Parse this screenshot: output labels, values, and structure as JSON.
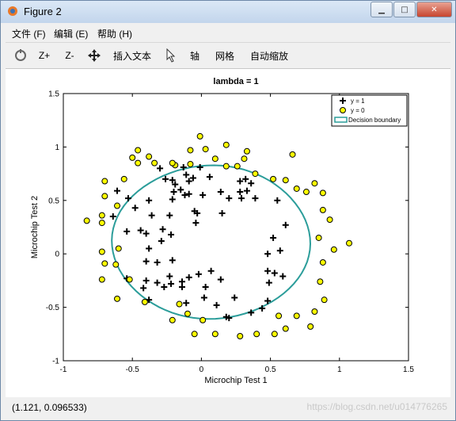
{
  "window": {
    "title": "Figure 2",
    "minimize_icon": "minimize-icon",
    "maximize_icon": "maximize-icon",
    "close_icon": "close-icon"
  },
  "menu": [
    {
      "label": "文件 (F)"
    },
    {
      "label": "编辑 (E)"
    },
    {
      "label": "帮助 (H)"
    }
  ],
  "toolbar": {
    "rotate_icon": "rotate-icon",
    "zoom_in": "Z+",
    "zoom_out": "Z-",
    "pan_icon": "pan-move-icon",
    "insert_text": "插入文本",
    "select_icon": "cursor-icon",
    "axes": "轴",
    "grid": "网格",
    "autoscale": "自动缩放"
  },
  "status": {
    "coords": "(1.121, 0.096533)",
    "watermark": "https://blog.csdn.net/u014776265"
  },
  "chart_data": {
    "type": "scatter",
    "title": "lambda = 1",
    "xlabel": "Microchip Test 1",
    "ylabel": "Microchip Test 2",
    "xlim": [
      -1,
      1.5
    ],
    "ylim": [
      -1,
      1.5
    ],
    "xticks": [
      "-1",
      "-0.5",
      "0",
      "0.5",
      "1",
      "1.5"
    ],
    "yticks": [
      "-1",
      "-0.5",
      "0",
      "0.5",
      "1",
      "1.5"
    ],
    "xtick_values": [
      -1,
      -0.5,
      0,
      0.5,
      1,
      1.5
    ],
    "ytick_values": [
      -1,
      -0.5,
      0,
      0.5,
      1,
      1.5
    ],
    "legend_position": "top-right",
    "legend": [
      "y = 1",
      "y = 0",
      "Decision boundary"
    ],
    "colors": {
      "positive": "#000000",
      "negative_fill": "#ffff00",
      "boundary": "#2b9d9a"
    },
    "series": [
      {
        "name": "y = 1",
        "marker": "plus",
        "points": [
          [
            -0.09,
            0.68
          ],
          [
            -0.21,
            0.69
          ],
          [
            -0.3,
            0.8
          ],
          [
            -0.26,
            0.7
          ],
          [
            -0.13,
            0.81
          ],
          [
            -0.11,
            0.74
          ],
          [
            -0.06,
            0.71
          ],
          [
            -0.01,
            0.81
          ],
          [
            0.06,
            0.72
          ],
          [
            0.14,
            0.58
          ],
          [
            0.2,
            0.52
          ],
          [
            0.29,
            0.52
          ],
          [
            0.33,
            0.59
          ],
          [
            0.28,
            0.68
          ],
          [
            0.32,
            0.7
          ],
          [
            0.28,
            0.58
          ],
          [
            -0.15,
            0.6
          ],
          [
            -0.2,
            0.58
          ],
          [
            -0.19,
            0.65
          ],
          [
            -0.12,
            0.55
          ],
          [
            -0.09,
            0.56
          ],
          [
            -0.21,
            0.51
          ],
          [
            -0.38,
            0.5
          ],
          [
            -0.48,
            0.43
          ],
          [
            -0.53,
            0.52
          ],
          [
            -0.61,
            0.59
          ],
          [
            -0.64,
            0.35
          ],
          [
            -0.54,
            0.21
          ],
          [
            -0.44,
            0.22
          ],
          [
            -0.38,
            0.05
          ],
          [
            -0.36,
            0.36
          ],
          [
            -0.23,
            0.36
          ],
          [
            -0.22,
            0.18
          ],
          [
            -0.29,
            0.12
          ],
          [
            -0.28,
            0.23
          ],
          [
            -0.32,
            -0.08
          ],
          [
            -0.4,
            -0.07
          ],
          [
            -0.21,
            -0.06
          ],
          [
            -0.23,
            -0.21
          ],
          [
            -0.22,
            -0.28
          ],
          [
            -0.32,
            -0.27
          ],
          [
            -0.4,
            -0.25
          ],
          [
            -0.42,
            -0.32
          ],
          [
            -0.38,
            -0.43
          ],
          [
            -0.27,
            -0.31
          ],
          [
            -0.14,
            -0.26
          ],
          [
            -0.09,
            -0.22
          ],
          [
            -0.02,
            -0.19
          ],
          [
            0.07,
            -0.16
          ],
          [
            0.14,
            -0.24
          ],
          [
            0.03,
            -0.31
          ],
          [
            -0.14,
            -0.31
          ],
          [
            -0.11,
            -0.46
          ],
          [
            0.02,
            -0.41
          ],
          [
            0.11,
            -0.48
          ],
          [
            0.24,
            -0.41
          ],
          [
            0.18,
            -0.59
          ],
          [
            0.2,
            -0.6
          ],
          [
            0.36,
            -0.55
          ],
          [
            0.44,
            -0.51
          ],
          [
            0.48,
            -0.44
          ],
          [
            0.49,
            -0.27
          ],
          [
            0.48,
            -0.16
          ],
          [
            0.53,
            -0.18
          ],
          [
            0.59,
            -0.21
          ],
          [
            0.48,
            0.0
          ],
          [
            0.57,
            0.03
          ],
          [
            0.52,
            0.15
          ],
          [
            0.61,
            0.27
          ],
          [
            0.55,
            0.5
          ],
          [
            0.39,
            0.52
          ],
          [
            0.36,
            0.66
          ],
          [
            -0.04,
            0.29
          ],
          [
            -0.03,
            0.38
          ],
          [
            0.15,
            0.38
          ],
          [
            -0.05,
            0.4
          ],
          [
            0.01,
            0.55
          ],
          [
            -0.54,
            -0.23
          ],
          [
            -0.4,
            0.19
          ]
        ]
      },
      {
        "name": "y = 0",
        "marker": "circle",
        "points": [
          [
            -0.83,
            0.31
          ],
          [
            -0.72,
            0.36
          ],
          [
            -0.7,
            0.54
          ],
          [
            -0.7,
            0.68
          ],
          [
            -0.72,
            0.29
          ],
          [
            -0.61,
            0.45
          ],
          [
            -0.56,
            0.7
          ],
          [
            -0.46,
            0.97
          ],
          [
            -0.38,
            0.91
          ],
          [
            -0.19,
            0.83
          ],
          [
            -0.08,
            0.97
          ],
          [
            -0.01,
            1.1
          ],
          [
            0.03,
            0.98
          ],
          [
            0.1,
            0.89
          ],
          [
            0.18,
            0.82
          ],
          [
            0.26,
            0.82
          ],
          [
            0.31,
            0.89
          ],
          [
            0.33,
            0.96
          ],
          [
            0.18,
            1.02
          ],
          [
            0.39,
            0.75
          ],
          [
            0.52,
            0.7
          ],
          [
            0.61,
            0.69
          ],
          [
            0.69,
            0.61
          ],
          [
            0.66,
            0.93
          ],
          [
            0.76,
            0.58
          ],
          [
            0.82,
            0.66
          ],
          [
            0.88,
            0.57
          ],
          [
            0.93,
            0.32
          ],
          [
            0.88,
            0.41
          ],
          [
            0.85,
            0.15
          ],
          [
            0.96,
            0.04
          ],
          [
            1.07,
            0.1
          ],
          [
            0.88,
            -0.08
          ],
          [
            0.86,
            -0.26
          ],
          [
            0.89,
            -0.43
          ],
          [
            0.82,
            -0.54
          ],
          [
            0.79,
            -0.68
          ],
          [
            0.69,
            -0.58
          ],
          [
            0.56,
            -0.58
          ],
          [
            0.61,
            -0.7
          ],
          [
            0.53,
            -0.75
          ],
          [
            0.4,
            -0.75
          ],
          [
            0.28,
            -0.77
          ],
          [
            0.1,
            -0.75
          ],
          [
            -0.05,
            -0.75
          ],
          [
            -0.21,
            -0.62
          ],
          [
            -0.41,
            -0.45
          ],
          [
            -0.52,
            -0.24
          ],
          [
            -0.61,
            -0.42
          ],
          [
            -0.72,
            -0.24
          ],
          [
            -0.7,
            -0.09
          ],
          [
            -0.72,
            0.02
          ],
          [
            -0.6,
            0.05
          ],
          [
            -0.62,
            -0.1
          ],
          [
            -0.5,
            0.9
          ],
          [
            -0.34,
            0.85
          ],
          [
            -0.21,
            0.85
          ],
          [
            -0.08,
            0.84
          ],
          [
            -0.46,
            0.85
          ],
          [
            -0.1,
            -0.56
          ],
          [
            0.01,
            -0.62
          ],
          [
            -0.16,
            -0.47
          ]
        ]
      }
    ]
  }
}
